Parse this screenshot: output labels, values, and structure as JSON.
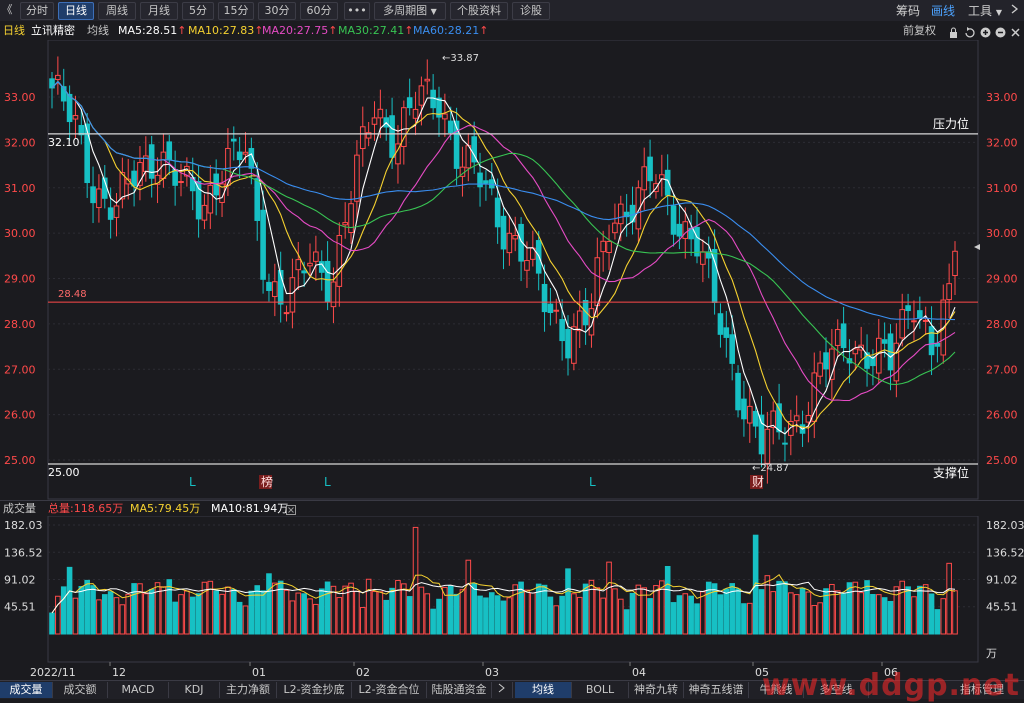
{
  "toolbar": {
    "back_glyph": "《",
    "periods": [
      "分时",
      "日线",
      "周线",
      "月线",
      "5分",
      "15分",
      "30分",
      "60分"
    ],
    "active_period": "日线",
    "more_glyph": "•••",
    "multi_period": "多周期图",
    "stock_info": "个股资料",
    "diagnose": "诊股",
    "right_items": [
      "筹码",
      "画线",
      "工具"
    ]
  },
  "info": {
    "period": "日线",
    "stock_name": "立讯精密",
    "avg_label": "均线",
    "ma5": "MA5:28.51",
    "ma10": "MA10:27.83",
    "ma20": "MA20:27.75",
    "ma30": "MA30:27.41",
    "ma60": "MA60:28.21",
    "up_arrow": "↑",
    "adjust": "前复权"
  },
  "colors": {
    "up": "#ff4a4a",
    "down": "#17c0c4",
    "ma5": "#ffffff",
    "ma10": "#f5d130",
    "ma20": "#e54bc4",
    "ma30": "#38c453",
    "ma60": "#3a8ef0",
    "axis_text": "#ff4a4a"
  },
  "price_axis": {
    "ticks": [
      "33.00",
      "32.00",
      "31.00",
      "30.00",
      "29.00",
      "28.00",
      "27.00",
      "26.00",
      "25.00"
    ]
  },
  "annotations": {
    "high": "33.87",
    "low": "24.87",
    "left_level": "32.10",
    "red_line": "28.48",
    "bottom_level": "25.00",
    "resistance": "压力位",
    "support": "支撑位",
    "markers": [
      "L",
      "榜",
      "L",
      "L",
      "财"
    ]
  },
  "volume": {
    "label": "成交量",
    "total": "总量:118.65万",
    "ma5": "MA5:79.45万",
    "ma10": "MA10:81.94万",
    "ticks": [
      "182.03",
      "136.52",
      "91.02",
      "45.51"
    ],
    "unit": "万"
  },
  "date_axis": [
    "2022/11",
    "12",
    "01",
    "02",
    "03",
    "04",
    "05",
    "06"
  ],
  "tabs": [
    "成交量",
    "成交额",
    "MACD",
    "KDJ",
    "主力净额",
    "L2-资金抄底",
    "L2-资金合位",
    "陆股通资金",
    "均线",
    "BOLL",
    "神奇九转",
    "神奇五线谱",
    "牛熊线",
    "多空线",
    "指标管理"
  ],
  "active_tab": "成交量",
  "watermark": "www.ddgp.net",
  "chart_data": {
    "type": "candlestick",
    "title": "立讯精密 日线",
    "ylim": [
      24.7,
      34.0
    ],
    "x": [
      "2022/11",
      "12",
      "01",
      "02",
      "03",
      "04",
      "05",
      "06"
    ],
    "ma_last": {
      "MA5": 28.51,
      "MA10": 27.83,
      "MA20": 27.75,
      "MA30": 27.41,
      "MA60": 28.21
    },
    "high": 33.87,
    "low": 24.87,
    "horizontal_lines": [
      32.1,
      28.48,
      25.0
    ],
    "close_key_points": [
      33.2,
      32.4,
      31.0,
      30.5,
      31.4,
      31.8,
      31.0,
      30.6,
      31.6,
      31.7,
      29.0,
      28.5,
      29.4,
      29.0,
      31.0,
      32.8,
      32.1,
      32.9,
      33.0,
      31.6,
      31.1,
      30.2,
      29.5,
      28.4,
      27.8,
      28.1,
      30.4,
      30.7,
      31.2,
      30.4,
      29.8,
      28.1,
      26.5,
      25.3,
      25.7,
      26.1,
      27.1,
      27.7,
      27.3,
      27.1,
      28.8,
      27.3,
      28.9
    ]
  }
}
